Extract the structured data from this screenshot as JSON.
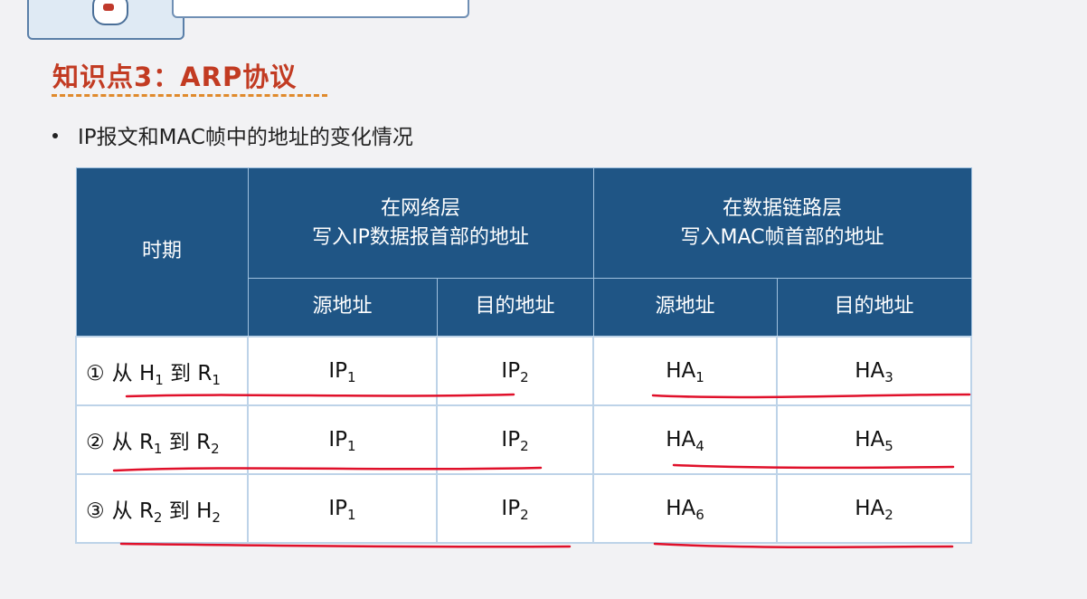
{
  "section_title": "知识点3：ARP协议",
  "bullet": "IP报文和MAC帧中的地址的变化情况",
  "table": {
    "col_period": "时期",
    "group_ip": {
      "line1": "在网络层",
      "line2": "写入IP数据报首部的地址"
    },
    "group_mac": {
      "line1": "在数据链路层",
      "line2": "写入MAC帧首部的地址"
    },
    "sub_src": "源地址",
    "sub_dst": "目的地址",
    "rows": [
      {
        "num": "①",
        "from": "从",
        "n1": "H",
        "s1": "1",
        "to": "到",
        "n2": "R",
        "s2": "1",
        "ip_src": "IP",
        "ip_src_sub": "1",
        "ip_dst": "IP",
        "ip_dst_sub": "2",
        "mac_src": "HA",
        "mac_src_sub": "1",
        "mac_dst": "HA",
        "mac_dst_sub": "3"
      },
      {
        "num": "②",
        "from": "从",
        "n1": "R",
        "s1": "1",
        "to": "到",
        "n2": "R",
        "s2": "2",
        "ip_src": "IP",
        "ip_src_sub": "1",
        "ip_dst": "IP",
        "ip_dst_sub": "2",
        "mac_src": "HA",
        "mac_src_sub": "4",
        "mac_dst": "HA",
        "mac_dst_sub": "5"
      },
      {
        "num": "③",
        "from": "从",
        "n1": "R",
        "s1": "2",
        "to": "到",
        "n2": "H",
        "s2": "2",
        "ip_src": "IP",
        "ip_src_sub": "1",
        "ip_dst": "IP",
        "ip_dst_sub": "2",
        "mac_src": "HA",
        "mac_src_sub": "6",
        "mac_dst": "HA",
        "mac_dst_sub": "2"
      }
    ]
  },
  "colors": {
    "title": "#c23b22",
    "header_bg": "#1f5585",
    "annotation": "#e0102a",
    "underline_dash": "#e08a2c"
  },
  "icons": [
    "presenter-illustration",
    "header-banner"
  ]
}
